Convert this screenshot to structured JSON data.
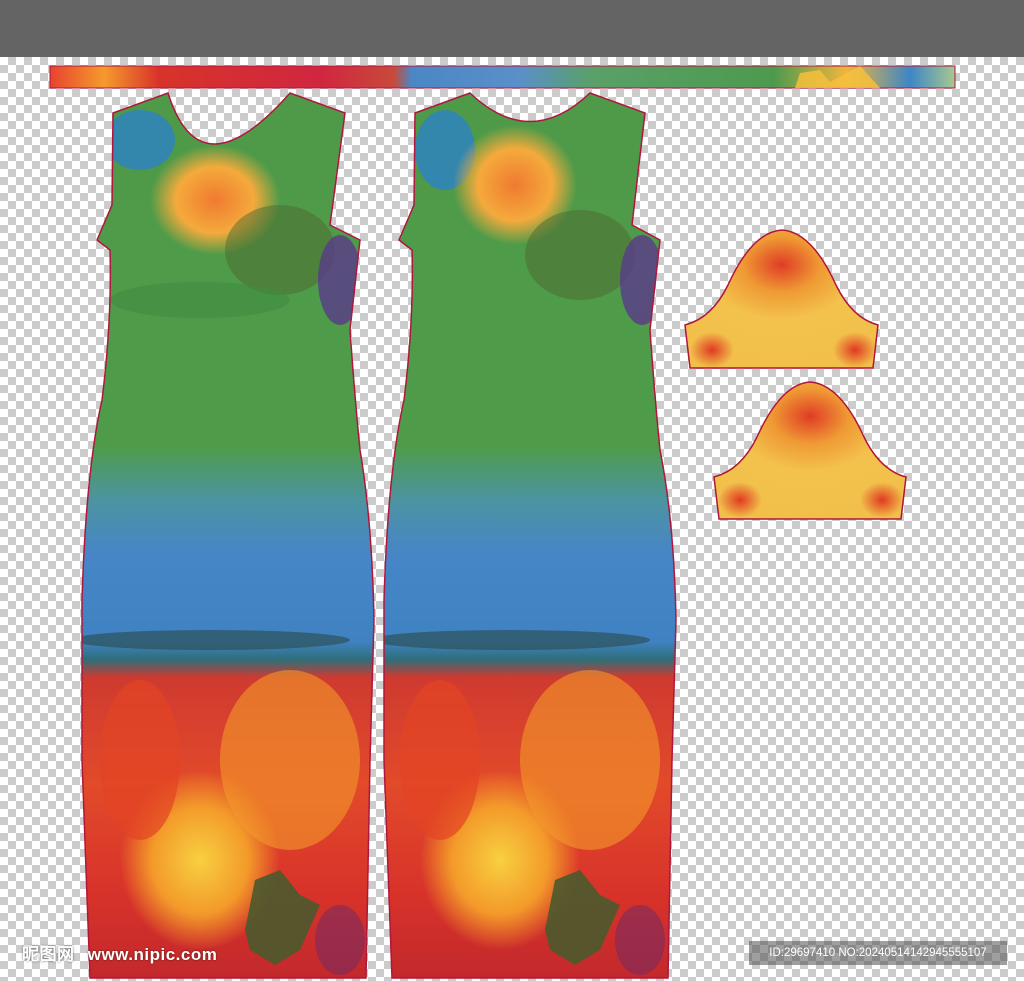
{
  "colors": {
    "toolbar": "#646464",
    "checker_light": "#ffffff",
    "checker_dark": "#cccccc",
    "outline": "#b0163c",
    "green": "#3f9a4c",
    "blue": "#3f86c4",
    "red": "#d8332a",
    "orange": "#ee9a2a",
    "yellow": "#f3c64a"
  },
  "pieces": [
    {
      "name": "waistband-strip"
    },
    {
      "name": "dress-front-panel"
    },
    {
      "name": "dress-back-panel"
    },
    {
      "name": "sleeve-piece-top"
    },
    {
      "name": "sleeve-piece-bottom"
    }
  ],
  "watermark": {
    "logo_text": "昵图网",
    "site": "www.nipic.com",
    "id_text": "ID:29697410 NO:20240514142945555107"
  }
}
